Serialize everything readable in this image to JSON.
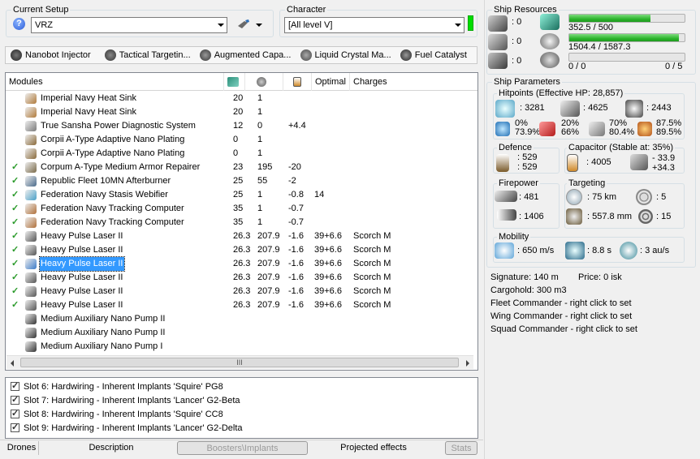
{
  "setup": {
    "group_label": "Current Setup",
    "value": "VRZ"
  },
  "character": {
    "group_label": "Character",
    "value": "[All level V]"
  },
  "boosters": [
    {
      "label": "Nanobot Injector",
      "icon": "nanobot-icon"
    },
    {
      "label": "Tactical Targetin...",
      "icon": "targeting-icon"
    },
    {
      "label": "Augmented Capa...",
      "icon": "capacitor-icon"
    },
    {
      "label": "Liquid Crystal Ma...",
      "icon": "crystal-icon"
    },
    {
      "label": "Fuel Catalyst",
      "icon": "fuel-icon"
    }
  ],
  "modules": {
    "headers": {
      "name": "Modules",
      "optimal": "Optimal",
      "charges": "Charges"
    },
    "rows": [
      {
        "active": false,
        "name": "Imperial Navy Heat Sink",
        "cpu": "20",
        "pg": "1",
        "cap": "",
        "optimal": "",
        "charges": "",
        "selected": false
      },
      {
        "active": false,
        "name": "Imperial Navy Heat Sink",
        "cpu": "20",
        "pg": "1",
        "cap": "",
        "optimal": "",
        "charges": "",
        "selected": false
      },
      {
        "active": false,
        "name": "True Sansha Power Diagnostic System",
        "cpu": "12",
        "pg": "0",
        "cap": "+4.4",
        "optimal": "",
        "charges": "",
        "selected": false
      },
      {
        "active": false,
        "name": "Corpii A-Type Adaptive Nano Plating",
        "cpu": "0",
        "pg": "1",
        "cap": "",
        "optimal": "",
        "charges": "",
        "selected": false
      },
      {
        "active": false,
        "name": "Corpii A-Type Adaptive Nano Plating",
        "cpu": "0",
        "pg": "1",
        "cap": "",
        "optimal": "",
        "charges": "",
        "selected": false
      },
      {
        "active": true,
        "name": "Corpum A-Type Medium Armor Repairer",
        "cpu": "23",
        "pg": "195",
        "cap": "-20",
        "optimal": "",
        "charges": "",
        "selected": false
      },
      {
        "active": true,
        "name": "Republic Fleet 10MN Afterburner",
        "cpu": "25",
        "pg": "55",
        "cap": "-2",
        "optimal": "",
        "charges": "",
        "selected": false
      },
      {
        "active": true,
        "name": "Federation Navy Stasis Webifier",
        "cpu": "25",
        "pg": "1",
        "cap": "-0.8",
        "optimal": "14",
        "charges": "",
        "selected": false
      },
      {
        "active": true,
        "name": "Federation Navy Tracking Computer",
        "cpu": "35",
        "pg": "1",
        "cap": "-0.7",
        "optimal": "",
        "charges": "",
        "selected": false
      },
      {
        "active": true,
        "name": "Federation Navy Tracking Computer",
        "cpu": "35",
        "pg": "1",
        "cap": "-0.7",
        "optimal": "",
        "charges": "",
        "selected": false
      },
      {
        "active": true,
        "name": "Heavy Pulse Laser II",
        "cpu": "26.3",
        "pg": "207.9",
        "cap": "-1.6",
        "optimal": "39+6.6",
        "charges": "Scorch M",
        "selected": false
      },
      {
        "active": true,
        "name": "Heavy Pulse Laser II",
        "cpu": "26.3",
        "pg": "207.9",
        "cap": "-1.6",
        "optimal": "39+6.6",
        "charges": "Scorch M",
        "selected": false
      },
      {
        "active": true,
        "name": "Heavy Pulse Laser II",
        "cpu": "26.3",
        "pg": "207.9",
        "cap": "-1.6",
        "optimal": "39+6.6",
        "charges": "Scorch M",
        "selected": true
      },
      {
        "active": true,
        "name": "Heavy Pulse Laser II",
        "cpu": "26.3",
        "pg": "207.9",
        "cap": "-1.6",
        "optimal": "39+6.6",
        "charges": "Scorch M",
        "selected": false
      },
      {
        "active": true,
        "name": "Heavy Pulse Laser II",
        "cpu": "26.3",
        "pg": "207.9",
        "cap": "-1.6",
        "optimal": "39+6.6",
        "charges": "Scorch M",
        "selected": false
      },
      {
        "active": true,
        "name": "Heavy Pulse Laser II",
        "cpu": "26.3",
        "pg": "207.9",
        "cap": "-1.6",
        "optimal": "39+6.6",
        "charges": "Scorch M",
        "selected": false
      },
      {
        "active": false,
        "name": "Medium Auxiliary Nano Pump II",
        "cpu": "",
        "pg": "",
        "cap": "",
        "optimal": "",
        "charges": "",
        "selected": false
      },
      {
        "active": false,
        "name": "Medium Auxiliary Nano Pump II",
        "cpu": "",
        "pg": "",
        "cap": "",
        "optimal": "",
        "charges": "",
        "selected": false
      },
      {
        "active": false,
        "name": "Medium Auxiliary Nano Pump I",
        "cpu": "",
        "pg": "",
        "cap": "",
        "optimal": "",
        "charges": "",
        "selected": false
      }
    ],
    "scroll_label": "III"
  },
  "implants": [
    "Slot 6: Hardwiring - Inherent Implants 'Squire' PG8",
    "Slot 7: Hardwiring - Inherent Implants 'Lancer' G2-Beta",
    "Slot 8: Hardwiring - Inherent Implants 'Squire' CC8",
    "Slot 9: Hardwiring - Inherent Implants 'Lancer' G2-Delta"
  ],
  "tabs": [
    "Drones",
    "Description",
    "Boosters\\Implants",
    "Projected effects",
    "Stats"
  ],
  "resources": {
    "title": "Ship Resources",
    "turret": ": 0",
    "launcher": ": 0",
    "rig": ": 0",
    "cpu_text": "352.5 / 500",
    "cpu_fill": 0.705,
    "pg_text": "1504.4 / 1587.3",
    "pg_fill": 0.948,
    "drone_text": "0 / 0",
    "drone_fill": 0,
    "drone_bw": "0 / 5"
  },
  "params": {
    "title": "Ship Parameters",
    "hp_title": "Hitpoints (Effective HP: 28,857)",
    "shield_hp": ": 3281",
    "armor_hp": ": 4625",
    "hull_hp": ": 2443",
    "res_em_top": "0%",
    "res_em_bot": "73.9%",
    "res_th_top": "20%",
    "res_th_bot": "66%",
    "res_ki_top": "70%",
    "res_ki_bot": "80.4%",
    "res_ex_top": "87.5%",
    "res_ex_bot": "89.5%",
    "defence_title": "Defence",
    "def_a": ": 529",
    "def_b": ": 529",
    "cap_title": "Capacitor (Stable at: 35%)",
    "cap_val": ": 4005",
    "cap_a": "- 33.9",
    "cap_b": "+34.3",
    "fp_title": "Firepower",
    "fp_a": ": 481",
    "fp_b": ": 1406",
    "tg_title": "Targeting",
    "tg_range": ": 75 km",
    "tg_max": ": 5",
    "tg_sig": ": 557.8 mm",
    "tg_sensor": ": 15",
    "mob_title": "Mobility",
    "mob_speed": ": 650 m/s",
    "mob_align": ": 8.8 s",
    "mob_warp": ": 3 au/s",
    "signature": "Signature: 140 m",
    "price": "Price: 0 isk",
    "cargohold": "Cargohold: 300 m3",
    "fleet": "Fleet Commander - right click to set",
    "wing": "Wing Commander - right click to set",
    "squad": "Squad Commander - right click to set"
  },
  "colors": {
    "green": "#2db52d",
    "selection": "#3399ff"
  }
}
